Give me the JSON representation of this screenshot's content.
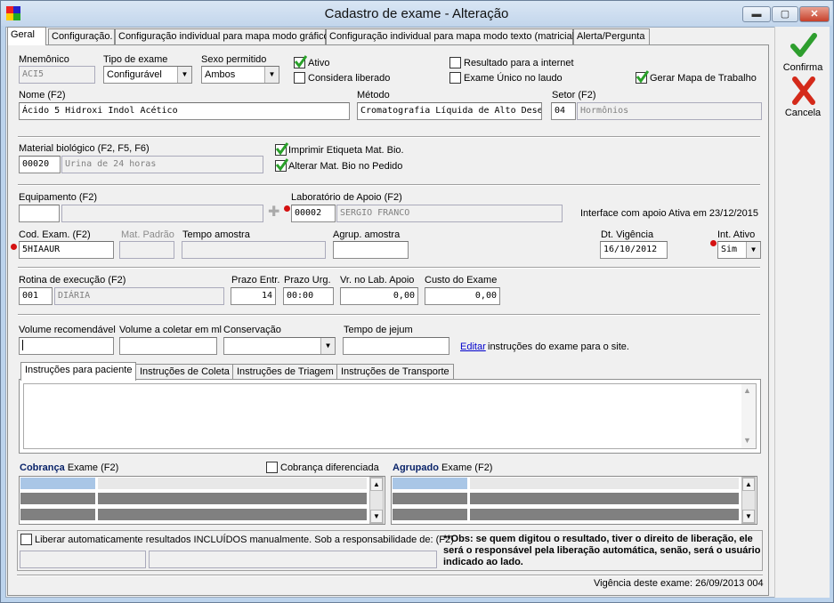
{
  "window": {
    "title": "Cadastro de exame - Alteração",
    "minimize": "▬",
    "maximize": "▢",
    "close": "✕"
  },
  "tabs": [
    "Geral",
    "Configuração.",
    "Configuração individual para mapa modo gráfico",
    "Configuração individual para mapa modo texto (matricial)",
    "Alerta/Pergunta"
  ],
  "sidebar": {
    "confirm_label": "Confirma",
    "cancel_label": "Cancela"
  },
  "form": {
    "mnemonico_label": "Mnemônico",
    "mnemonico_value": "ACI5",
    "tipo_exame_label": "Tipo de exame",
    "tipo_exame_value": "Configurável",
    "sexo_label": "Sexo permitido",
    "sexo_value": "Ambos",
    "ativo_label": "Ativo",
    "ativo_checked": true,
    "considera_label": "Considera liberado",
    "considera_checked": false,
    "resultado_internet_label": "Resultado para a internet",
    "resultado_internet_checked": false,
    "exame_unico_label": "Exame Único no laudo",
    "exame_unico_checked": false,
    "gerar_mapa_label": "Gerar Mapa de Trabalho",
    "gerar_mapa_checked": true,
    "nome_label": "Nome (F2)",
    "nome_value": "Ácido 5 Hidroxi Indol Acético",
    "metodo_label": "Método",
    "metodo_value": "Cromatografia Líquida de Alto Desempe",
    "setor_label": "Setor (F2)",
    "setor_code": "04",
    "setor_name": "Hormônios",
    "material_label": "Material biológico (F2, F5, F6)",
    "material_code": "00020",
    "material_name": "Urina de 24 horas",
    "imprimir_etiqueta_label": "Imprimir Etiqueta Mat. Bio.",
    "imprimir_etiqueta_checked": true,
    "alterar_mat_label": "Alterar Mat. Bio no Pedido",
    "alterar_mat_checked": true,
    "equipamento_label": "Equipamento (F2)",
    "equipamento_code": "",
    "equipamento_name": "",
    "laboratorio_label": "Laboratório de Apoio (F2)",
    "laboratorio_code": "00002",
    "laboratorio_name": "SERGIO FRANCO",
    "interface_text": "Interface com apoio Ativa em 23/12/2015",
    "cod_exam_label": "Cod. Exam. (F2)",
    "cod_exam_value": "5HIAAUR",
    "mat_padrao_label": "Mat. Padrão",
    "tempo_amostra_label": "Tempo amostra",
    "agrup_amostra_label": "Agrup. amostra",
    "dt_vigencia_label": "Dt. Vigência",
    "dt_vigencia_value": "16/10/2012",
    "int_ativo_label": "Int. Ativo",
    "int_ativo_value": "Sim",
    "rotina_label": "Rotina de execução (F2)",
    "rotina_code": "001",
    "rotina_name": "DIÁRIA",
    "prazo_entr_label": "Prazo Entr.",
    "prazo_entr_value": "14",
    "prazo_urg_label": "Prazo Urg.",
    "prazo_urg_value": "00:00",
    "vr_lab_label": "Vr. no Lab. Apoio",
    "vr_lab_value": "0,00",
    "custo_label": "Custo do Exame",
    "custo_value": "0,00",
    "volume_rec_label": "Volume recomendável",
    "volume_coletar_label": "Volume a coletar em ml",
    "conservacao_label": "Conservação",
    "tempo_jejum_label": "Tempo de jejum",
    "editar_link": "Editar",
    "editar_suffix": "instruções do exame para o site."
  },
  "instr_tabs": [
    "Instruções para paciente",
    "Instruções de Coleta",
    "Instruções de Triagem",
    "Instruções de Transporte"
  ],
  "cobranca": {
    "bold": "Cobrança",
    "rest": "Exame (F2)",
    "diferenciada_label": "Cobrança diferenciada"
  },
  "agrupado": {
    "bold": "Agrupado",
    "rest": "Exame (F2)"
  },
  "liberar_label": "Liberar automaticamente resultados INCLUÍDOS manualmente. Sob a responsabilidade de: (F2)",
  "obs_text": "**Obs: se quem digitou o resultado, tiver o direito de liberação, ele será o responsável pela liberação automática, senão, será o usuário indicado ao lado.",
  "status_text": "Vigência deste exame: 26/09/2013 004",
  "colors": {
    "accent_red": "#d41111",
    "grid_highlight": "#a9c6e6",
    "grid_row": "#808080",
    "section_blue": "#0a246a"
  }
}
